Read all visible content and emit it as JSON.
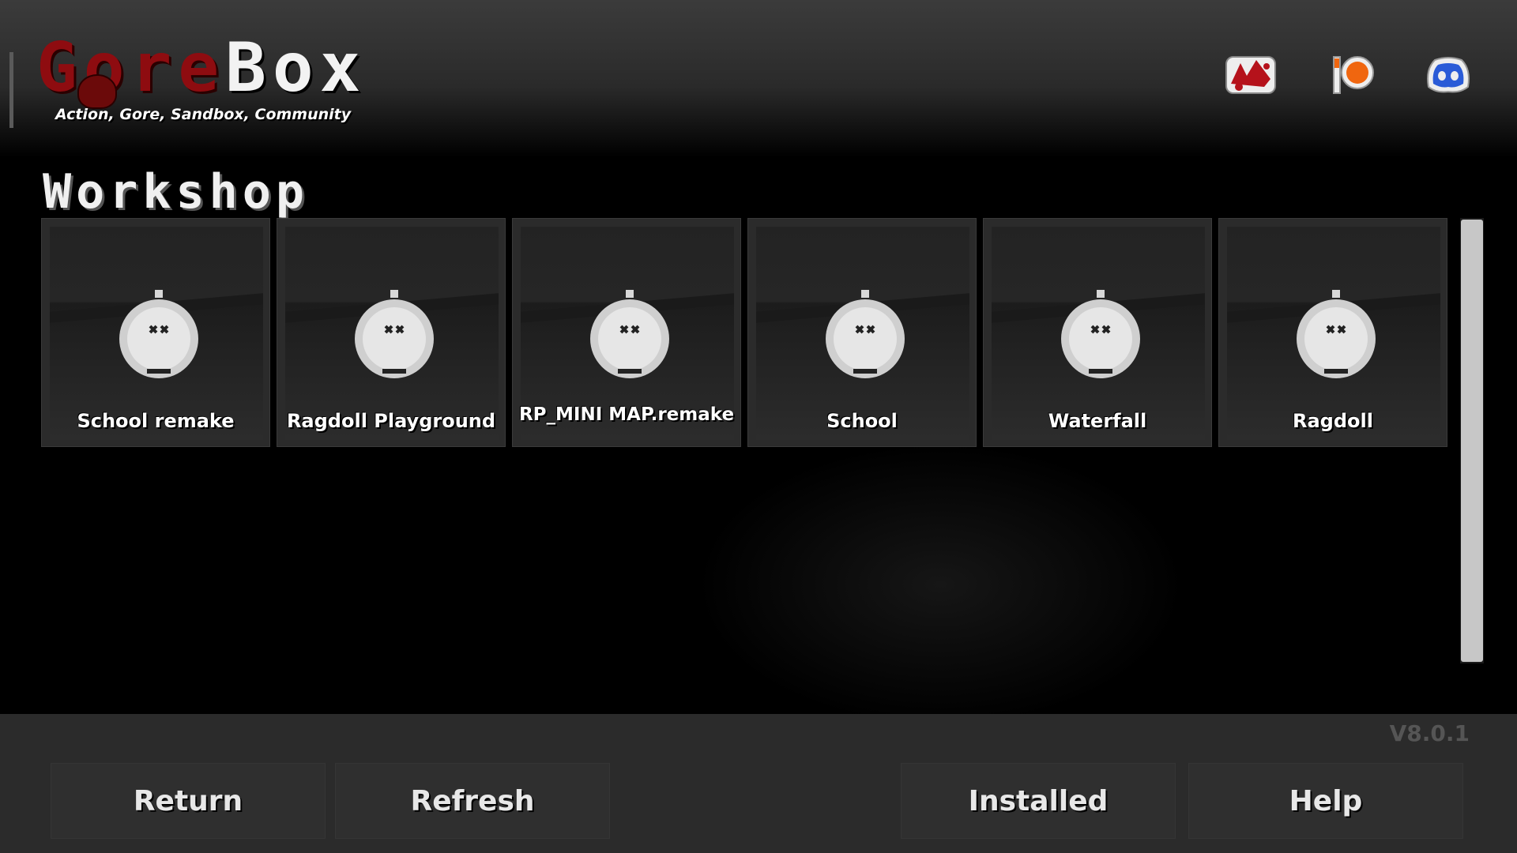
{
  "app": {
    "logo_text_part1": "G",
    "logo_text_part2": "ore",
    "logo_text_part3": "Box",
    "tagline": "Action, Gore, Sandbox, Community"
  },
  "social_links": [
    {
      "icon": "gorebox-red-icon",
      "color": "#c4161c"
    },
    {
      "icon": "patreon-icon",
      "color": "#f96854"
    },
    {
      "icon": "discord-icon",
      "color": "#2a5bd7"
    }
  ],
  "page": {
    "title": "Workshop"
  },
  "workshop_items": [
    {
      "label": "School remake"
    },
    {
      "label": "Ragdoll Playground"
    },
    {
      "label": "RP_MINI MAP.remake"
    },
    {
      "label": "School"
    },
    {
      "label": "Waterfall"
    },
    {
      "label": "Ragdoll"
    }
  ],
  "version": "V8.0.1",
  "footer": {
    "return_label": "Return",
    "refresh_label": "Refresh",
    "installed_label": "Installed",
    "help_label": "Help"
  },
  "colors": {
    "accent_blood": "#8e0c10",
    "scrollbar": "#c7c7c7",
    "footer_bg": "#2b2b2b"
  }
}
